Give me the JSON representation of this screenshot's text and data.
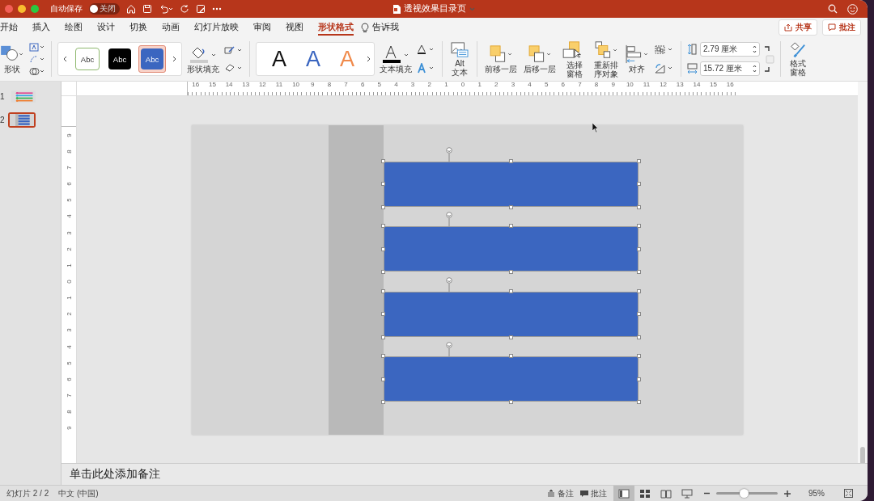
{
  "window": {
    "title": "透视效果目录页",
    "autosave_label": "自动保存",
    "autosave_toggle": {
      "label": "关闭",
      "on": false
    }
  },
  "menu_tabs": [
    {
      "label": "开始",
      "selected": false
    },
    {
      "label": "插入",
      "selected": false
    },
    {
      "label": "绘图",
      "selected": false
    },
    {
      "label": "设计",
      "selected": false
    },
    {
      "label": "切换",
      "selected": false
    },
    {
      "label": "动画",
      "selected": false
    },
    {
      "label": "幻灯片放映",
      "selected": false
    },
    {
      "label": "审阅",
      "selected": false
    },
    {
      "label": "视图",
      "selected": false
    },
    {
      "label": "形状格式",
      "selected": true
    }
  ],
  "tell_me": "告诉我",
  "share_button": "共享",
  "comments_button": "批注",
  "ribbon": {
    "insert_shape_label": "形状",
    "shape_styles": [
      {
        "label": "Abc",
        "kind": "outline",
        "selected": false
      },
      {
        "label": "Abc",
        "kind": "dark",
        "selected": false
      },
      {
        "label": "Abc",
        "kind": "accent",
        "selected": true
      }
    ],
    "shape_fill_label": "形状填充",
    "wordart_styles": [
      {
        "label": "A",
        "color": "#111111"
      },
      {
        "label": "A",
        "color": "#3b66c0"
      },
      {
        "label": "A",
        "color": "#f08a4b"
      }
    ],
    "text_fill_label": "文本填充",
    "alt_text_label": "Alt\n文本",
    "arrange": [
      "前移一层",
      "后移一层",
      "选择窗格",
      "重新排序对象",
      "对齐"
    ],
    "height": "2.79 厘米",
    "width": "15.72 厘米",
    "format_pane_label": "格式窗格"
  },
  "slides": [
    {
      "number": "1",
      "kind": "lines",
      "selected": false
    },
    {
      "number": "2",
      "kind": "bars",
      "selected": true
    }
  ],
  "rulers": {
    "horizontal": [
      "16",
      "15",
      "14",
      "13",
      "12",
      "11",
      "10",
      "9",
      "8",
      "7",
      "6",
      "5",
      "4",
      "3",
      "2",
      "1",
      "0",
      "1",
      "2",
      "3",
      "4",
      "5",
      "6",
      "7",
      "8",
      "9",
      "10",
      "11",
      "12",
      "13",
      "14",
      "15",
      "16"
    ],
    "vertical": [
      "9",
      "8",
      "7",
      "6",
      "5",
      "4",
      "3",
      "2",
      "1",
      "0",
      "1",
      "2",
      "3",
      "4",
      "5",
      "6",
      "7",
      "8",
      "9"
    ]
  },
  "slide": {
    "shapes": [
      {
        "selected": true
      },
      {
        "selected": true
      },
      {
        "selected": true
      },
      {
        "selected": true
      }
    ]
  },
  "notes_placeholder": "单击此处添加备注",
  "status": {
    "slide": "幻灯片 2 / 2",
    "language": "中文 (中国)",
    "notes": "备注",
    "comments": "批注",
    "views": [
      {
        "kind": "normal",
        "selected": true
      },
      {
        "kind": "sorter",
        "selected": false
      },
      {
        "kind": "reading",
        "selected": false
      },
      {
        "kind": "show",
        "selected": false
      }
    ],
    "zoom": {
      "level": 0.45,
      "percent": "95%"
    }
  }
}
